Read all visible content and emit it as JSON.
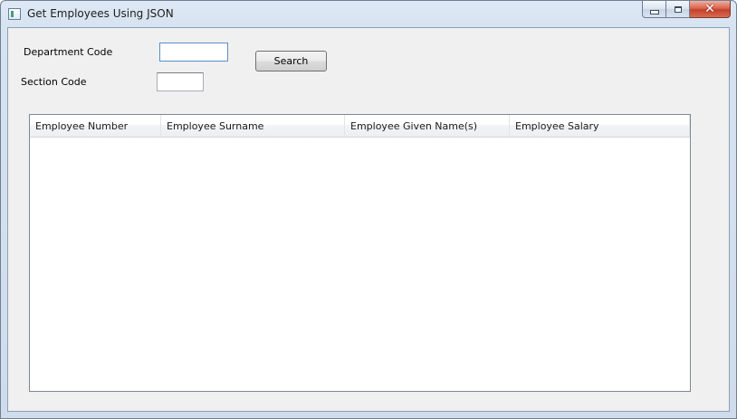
{
  "window": {
    "title": "Get Employees Using JSON"
  },
  "form": {
    "department_label": "Department Code",
    "department_value": "",
    "section_label": "Section Code",
    "section_value": "",
    "search_label": "Search"
  },
  "table": {
    "columns": [
      "Employee Number",
      "Employee Surname",
      "Employee Given Name(s)",
      "Employee Salary"
    ],
    "rows": []
  },
  "icons": {
    "app": "window-app-icon",
    "minimize": "minimize-icon",
    "maximize": "maximize-icon",
    "close": "close-icon"
  },
  "colors": {
    "frame": "#d7e3f1",
    "client": "#f0f0f0",
    "close_button": "#c4412b"
  }
}
